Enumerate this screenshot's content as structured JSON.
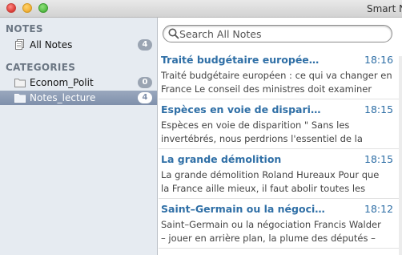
{
  "window": {
    "title": "Smart N"
  },
  "sidebar": {
    "notes_header": "NOTES",
    "all_notes": {
      "label": "All Notes",
      "count": "4"
    },
    "categories_header": "CATEGORIES",
    "categories": [
      {
        "label": "Econom_Polit",
        "count": "0"
      },
      {
        "label": "Notes_lecture",
        "count": "4",
        "selected": true
      }
    ]
  },
  "search": {
    "placeholder": "Search All Notes",
    "value": ""
  },
  "notes": [
    {
      "title": "Traité budgétaire européen…",
      "time": "18:16",
      "line1": "Traité budgétaire européen : ce qui va changer en",
      "line2": "France Le conseil des ministres doit examiner"
    },
    {
      "title": "Espèces en voie de disparition",
      "time": "18:15",
      "line1": "Espèces en voie de disparition  \" Sans les",
      "line2": "invertébrés, nous perdrions l'essentiel de la"
    },
    {
      "title": "La grande démolition",
      "time": "18:15",
      "line1": "La grande démolition Roland Hureaux  Pour que",
      "line2": "la France aille mieux, il faut abolir toutes les"
    },
    {
      "title": "Saint–Germain ou la négoci…",
      "time": "18:12",
      "line1": "Saint–Germain ou la négociation Francis Walder",
      "line2": "– jouer en arrière plan, la plume des députés –"
    }
  ],
  "colors": {
    "accent": "#2f6fa6",
    "sidebar_bg": "#e6ebf1",
    "selection": "#8a9ab3"
  }
}
